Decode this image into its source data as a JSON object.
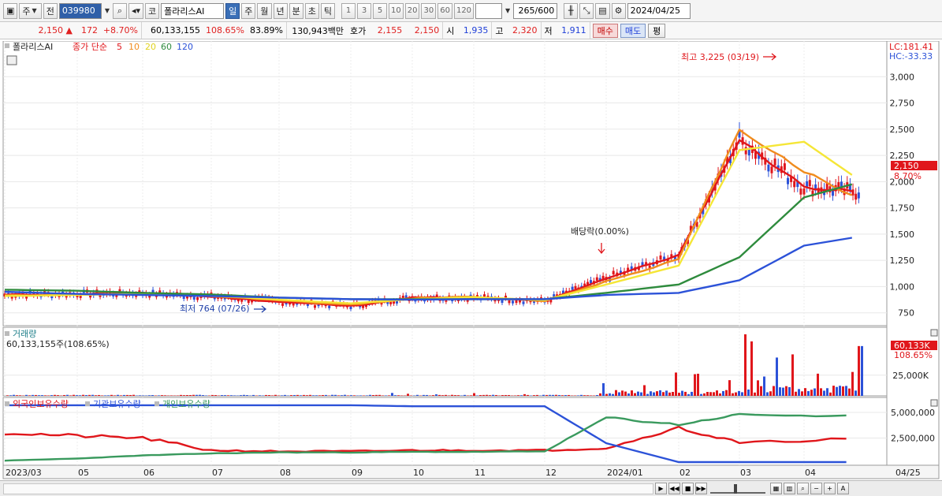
{
  "toolbar": {
    "market_label": "주",
    "prev_label": "전",
    "stock_code": "039980",
    "stock_kind": "코",
    "stock_name": "폴라리스AI",
    "periods": [
      "일",
      "주",
      "월",
      "년",
      "분",
      "초",
      "틱"
    ],
    "active_period": "일",
    "intervals": [
      "1",
      "3",
      "5",
      "10",
      "20",
      "30",
      "60",
      "120"
    ],
    "count_value": "265",
    "count_total": "/600",
    "date_value": "2024/04/25"
  },
  "quote": {
    "price": "2,150",
    "change_arrow": "▲",
    "change": "172",
    "change_pct": "+8.70%",
    "volume": "60,133,155",
    "volume_ratio": "108.65%",
    "turnover": "83.89%",
    "amount": "130,943백만",
    "bid_label": "호가",
    "ask_price": "2,155",
    "bid_price": "2,150",
    "open_label": "시",
    "open": "1,935",
    "high_label": "고",
    "high": "2,320",
    "low_label": "저",
    "low": "1,911",
    "buy_label": "매수",
    "sell_label": "매도",
    "eval_label": "평"
  },
  "main_chart": {
    "legend_name": "폴라리스AI",
    "legend_ma": "종가 단순",
    "ma_periods": [
      "5",
      "10",
      "20",
      "60",
      "120"
    ],
    "lc_label": "LC:181.41",
    "hc_label": "HC:-33.33",
    "high_annotation": "최고 3,225 (03/19)",
    "low_annotation": "최저 764 (07/26)",
    "dividend_annotation": "배당락(0.00%)",
    "price_badge": "2,150",
    "pct_badge": "8.70%"
  },
  "volume_chart": {
    "title": "거래량",
    "value_label": "60,133,155주(108.65%)",
    "badge": "60,133K",
    "badge_pct": "108.65%"
  },
  "holding_chart": {
    "legend": [
      "외국인보유수량",
      "기관보유수량",
      "개인보유수량"
    ]
  },
  "colors": {
    "ma5": "#e0161b",
    "ma10": "#f08c1e",
    "ma20": "#f5e637",
    "ma60": "#2e8b3d",
    "ma120": "#2c52d8",
    "up": "#e0161b",
    "down": "#2c52d8",
    "foreign": "#e0161b",
    "institution": "#2c52d8",
    "individual": "#3a9a5e"
  },
  "chart_data": [
    {
      "type": "line",
      "title": "",
      "x": [
        "2023/03",
        "05",
        "06",
        "07",
        "08",
        "09",
        "10",
        "11",
        "12",
        "2024/01",
        "02",
        "03",
        "04",
        "04/25"
      ],
      "ylim": [
        650,
        3250
      ],
      "yticks": [
        750,
        1000,
        1250,
        1500,
        1750,
        2000,
        2250,
        2500,
        2750,
        3000
      ],
      "series": [
        {
          "name": "5",
          "values": [
            920,
            930,
            935,
            905,
            855,
            815,
            895,
            895,
            860,
            1080,
            1300,
            2400,
            1950,
            1900
          ]
        },
        {
          "name": "10",
          "values": [
            915,
            925,
            935,
            910,
            865,
            825,
            890,
            900,
            865,
            1050,
            1260,
            2500,
            2100,
            1820
          ]
        },
        {
          "name": "20",
          "values": [
            910,
            920,
            930,
            915,
            875,
            840,
            880,
            900,
            870,
            1020,
            1200,
            2300,
            2380,
            2000
          ]
        },
        {
          "name": "60",
          "values": [
            970,
            960,
            940,
            925,
            895,
            880,
            880,
            880,
            880,
            940,
            1020,
            1280,
            1850,
            2000
          ]
        },
        {
          "name": "120",
          "values": [
            950,
            930,
            920,
            910,
            895,
            880,
            875,
            880,
            880,
            920,
            940,
            1060,
            1390,
            1480
          ]
        }
      ],
      "annotations": [
        "최고 3,225 (03/19)",
        "최저 764 (07/26)",
        "배당락(0.00%)"
      ]
    },
    {
      "type": "bar",
      "title": "거래량",
      "yticks": [
        "25,000K"
      ],
      "ylim": [
        0,
        80000
      ],
      "last_value": 60133
    },
    {
      "type": "line",
      "title": "",
      "x": [
        "2023/03",
        "05",
        "06",
        "07",
        "08",
        "09",
        "10",
        "11",
        "12",
        "2024/01",
        "02",
        "03",
        "04"
      ],
      "ylim": [
        0,
        6000000
      ],
      "yticks": [
        2500000,
        5000000
      ],
      "series": [
        {
          "name": "외국인보유수량",
          "values": [
            3000000,
            2700000,
            2500000,
            1300000,
            1200000,
            1200000,
            1300000,
            1300000,
            1300000,
            1500000,
            3500000,
            2000000,
            2500000
          ]
        },
        {
          "name": "기관보유수량",
          "values": [
            5700000,
            5700000,
            5700000,
            5700000,
            5700000,
            5700000,
            5600000,
            5600000,
            5600000,
            2000000,
            150000,
            150000,
            150000
          ]
        },
        {
          "name": "개인보유수량",
          "values": [
            300000,
            500000,
            800000,
            1000000,
            1100000,
            1100000,
            1150000,
            1150000,
            1200000,
            4500000,
            3800000,
            4800000,
            4600000
          ]
        }
      ]
    }
  ]
}
